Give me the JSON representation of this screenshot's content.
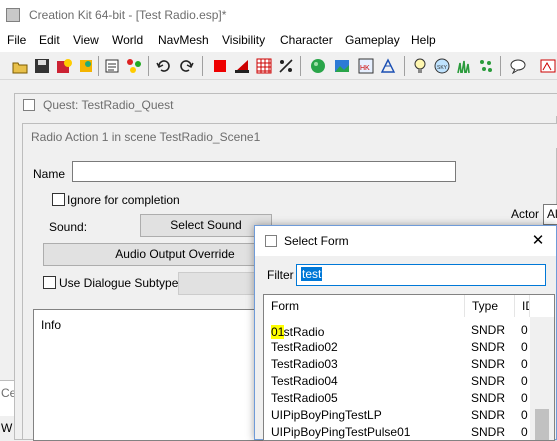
{
  "app": {
    "title": "Creation Kit 64-bit - [Test Radio.esp]*",
    "menus": [
      "File",
      "Edit",
      "View",
      "World",
      "NavMesh",
      "Visibility",
      "Character",
      "Gameplay",
      "Help"
    ]
  },
  "quest_window": {
    "title": "Quest: TestRadio_Quest"
  },
  "radio_window": {
    "title": "Radio Action 1 in scene TestRadio_Scene1",
    "name_label": "Name",
    "name_value": "",
    "ignore_label": "Ignore for completion",
    "sound_label": "Sound:",
    "select_sound_label": "Select Sound",
    "audio_override_label": "Audio Output Override",
    "use_dialogue_subtype_label": "Use Dialogue Subtype",
    "info_label": "Info",
    "actor_label": "Actor",
    "actor_value": "Ali"
  },
  "behind_labels": {
    "left1": "Ce",
    "left2": "W"
  },
  "select_form": {
    "title": "Select Form",
    "close_glyph": "✕",
    "filter_label": "Filter",
    "filter_value": "test",
    "columns": [
      "Form",
      "Type",
      "ID"
    ],
    "rows": [
      {
        "form_a": "TestRadio",
        "form_hl": "01",
        "type": "SNDR",
        "id": "0"
      },
      {
        "form_a": "TestRadio02",
        "form_hl": "",
        "type": "SNDR",
        "id": "0"
      },
      {
        "form_a": "TestRadio03",
        "form_hl": "",
        "type": "SNDR",
        "id": "0"
      },
      {
        "form_a": "TestRadio04",
        "form_hl": "",
        "type": "SNDR",
        "id": "0"
      },
      {
        "form_a": "TestRadio05",
        "form_hl": "",
        "type": "SNDR",
        "id": "0"
      },
      {
        "form_a": "UIPipBoyPingTestLP",
        "form_hl": "",
        "type": "SNDR",
        "id": "0"
      },
      {
        "form_a": "UIPipBoyPingTestPulse01",
        "form_hl": "",
        "type": "SNDR",
        "id": "0"
      }
    ],
    "highlight_color": "#ffff00"
  },
  "toolbar_icons": [
    "open-icon",
    "save-icon",
    "data-icon",
    "preferences-icon",
    "properties-icon",
    "references-icon",
    "undo-icon",
    "redo-icon",
    "cell-icon",
    "landscape-icon",
    "grid-icon",
    "snap-icon",
    "sphere-icon",
    "landscape-edit-icon",
    "havok-icon",
    "navmesh-icon",
    "lightbulb-icon",
    "sky-icon",
    "grass-icon",
    "dots-icon",
    "chat-icon",
    "extra-icon"
  ]
}
